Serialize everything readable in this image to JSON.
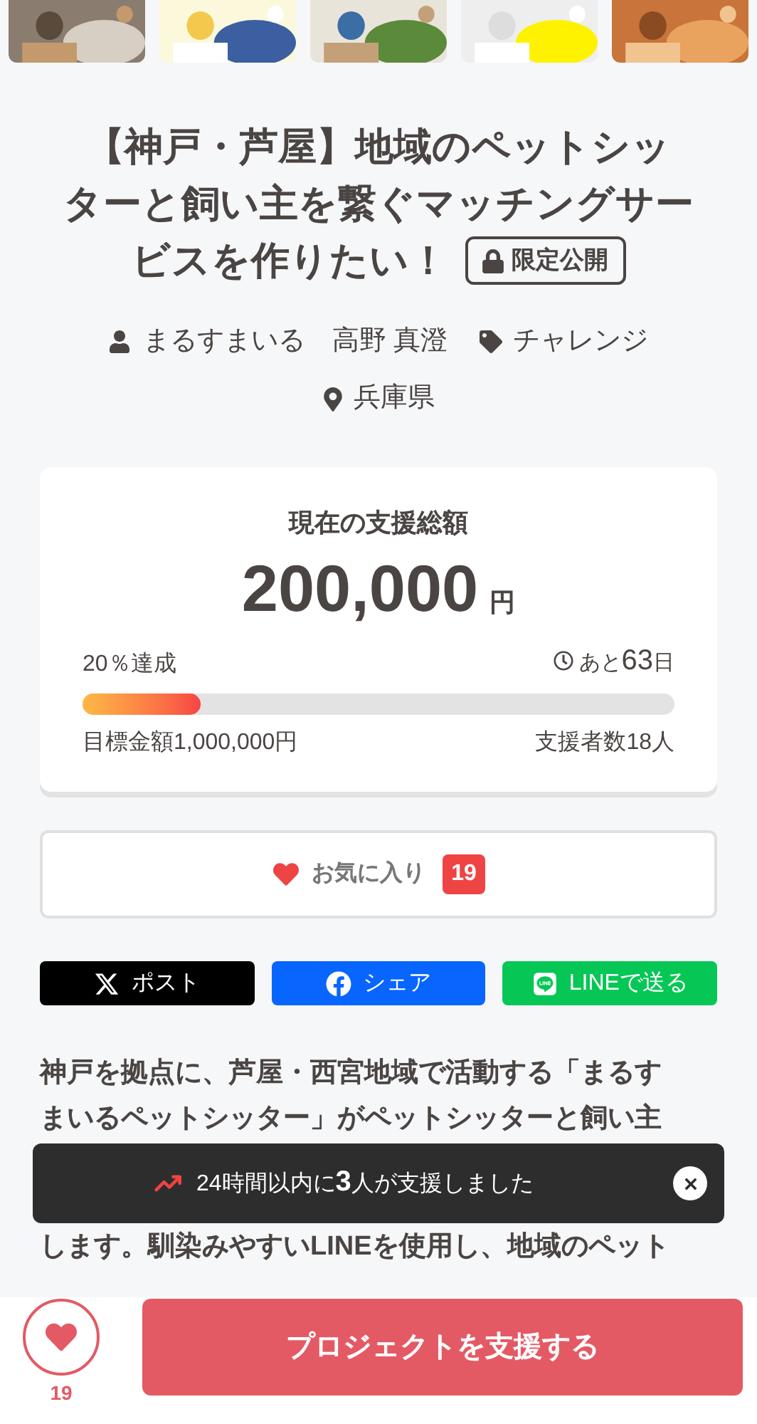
{
  "project": {
    "title_lines": [
      "【神戸・芦屋】地域のペットシッ",
      "ターと飼い主を繋ぐマッチングサー",
      "ビスを作りたい！"
    ],
    "badge": "限定公開",
    "owner": "まるすまいる　高野 真澄",
    "category": "チャレンジ",
    "location": "兵庫県"
  },
  "funding": {
    "label": "現在の支援総額",
    "amount": "200,000",
    "currency": "円",
    "achieved": "20％達成",
    "remaining_prefix": "あと",
    "remaining_days": "63",
    "remaining_unit": "日",
    "level": 0.2,
    "goal": "目標金額1,000,000円",
    "backers": "支援者数18人"
  },
  "favorite": {
    "label": "お気に入り",
    "count": "19"
  },
  "share": [
    {
      "kind": "x",
      "label": "ポスト"
    },
    {
      "kind": "facebook",
      "label": "シェア"
    },
    {
      "kind": "line",
      "label": "LINEで送る"
    }
  ],
  "description_lines": [
    "神戸を拠点に、芦屋・西宮地域で活動する「まるす",
    "まいるペットシッター」がペットシッターと飼い主",
    "します。馴染みやすいLINEを使用し、地域のペット"
  ],
  "toast": {
    "text": "24時間以内に**3**人が支援しました"
  },
  "bottom_bar": {
    "favorite_count": "19",
    "support_button": "プロジェクトを支援する"
  }
}
